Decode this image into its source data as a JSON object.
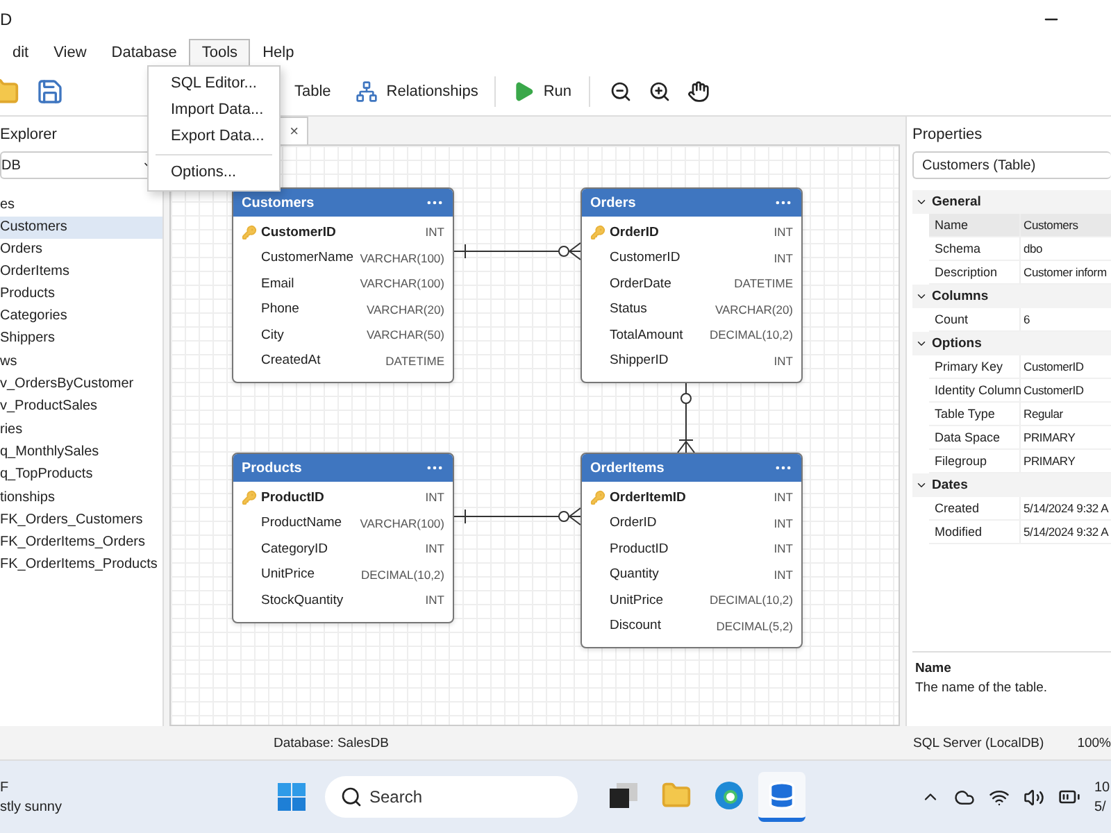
{
  "title_bar": {
    "title": "D"
  },
  "menu_bar": [
    {
      "label": "dit",
      "selected": false
    },
    {
      "label": "View",
      "selected": false
    },
    {
      "label": "Database",
      "selected": false
    },
    {
      "label": "Tools",
      "selected": true
    },
    {
      "label": "Help",
      "selected": false
    }
  ],
  "tools_menu": [
    {
      "kind": "item",
      "label": "SQL Editor..."
    },
    {
      "kind": "item",
      "label": "Import Data..."
    },
    {
      "kind": "item",
      "label": "Export Data..."
    },
    {
      "kind": "separator"
    },
    {
      "kind": "item",
      "label": "Options..."
    }
  ],
  "toolbar": [
    {
      "label": "Table"
    },
    {
      "label": "Relationships"
    },
    {
      "label": "Run"
    }
  ],
  "explorer": {
    "title": "Explorer",
    "database": "DB",
    "tree": [
      {
        "label": "es",
        "children": [
          {
            "label": "Customers",
            "selected": true
          },
          {
            "label": "Orders",
            "selected": false
          },
          {
            "label": "OrderItems",
            "selected": false
          },
          {
            "label": "Products",
            "selected": false
          },
          {
            "label": "Categories",
            "selected": false
          },
          {
            "label": "Shippers",
            "selected": false
          }
        ]
      },
      {
        "label": "ws",
        "children": [
          {
            "label": "v_OrdersByCustomer",
            "selected": false
          },
          {
            "label": "v_ProductSales",
            "selected": false
          }
        ]
      },
      {
        "label": "ries",
        "children": [
          {
            "label": "q_MonthlySales",
            "selected": false
          },
          {
            "label": "q_TopProducts",
            "selected": false
          }
        ]
      },
      {
        "label": "tionships",
        "children": [
          {
            "label": "FK_Orders_Customers",
            "selected": false
          },
          {
            "label": "FK_OrderItems_Orders",
            "selected": false
          },
          {
            "label": "FK_OrderItems_Products",
            "selected": false
          }
        ]
      }
    ]
  },
  "editor_tab": {
    "close": "×"
  },
  "diagram": {
    "entities": [
      {
        "name": "Customers",
        "columns": [
          {
            "name": "CustomerID",
            "type": "INT",
            "primary_key": true
          },
          {
            "name": "CustomerName",
            "type": "VARCHAR(100)",
            "primary_key": false
          },
          {
            "name": "Email",
            "type": "VARCHAR(100)",
            "primary_key": false
          },
          {
            "name": "Phone",
            "type": "VARCHAR(20)",
            "primary_key": false
          },
          {
            "name": "City",
            "type": "VARCHAR(50)",
            "primary_key": false
          },
          {
            "name": "CreatedAt",
            "type": "DATETIME",
            "primary_key": false
          }
        ]
      },
      {
        "name": "Orders",
        "columns": [
          {
            "name": "OrderID",
            "type": "INT",
            "primary_key": true
          },
          {
            "name": "CustomerID",
            "type": "INT",
            "primary_key": false
          },
          {
            "name": "OrderDate",
            "type": "DATETIME",
            "primary_key": false
          },
          {
            "name": "Status",
            "type": "VARCHAR(20)",
            "primary_key": false
          },
          {
            "name": "TotalAmount",
            "type": "DECIMAL(10,2)",
            "primary_key": false
          },
          {
            "name": "ShipperID",
            "type": "INT",
            "primary_key": false
          }
        ]
      },
      {
        "name": "Products",
        "columns": [
          {
            "name": "ProductID",
            "type": "INT",
            "primary_key": true
          },
          {
            "name": "ProductName",
            "type": "VARCHAR(100)",
            "primary_key": false
          },
          {
            "name": "CategoryID",
            "type": "INT",
            "primary_key": false
          },
          {
            "name": "UnitPrice",
            "type": "DECIMAL(10,2)",
            "primary_key": false
          },
          {
            "name": "StockQuantity",
            "type": "INT",
            "primary_key": false
          }
        ]
      },
      {
        "name": "OrderItems",
        "columns": [
          {
            "name": "OrderItemID",
            "type": "INT",
            "primary_key": true
          },
          {
            "name": "OrderID",
            "type": "INT",
            "primary_key": false
          },
          {
            "name": "ProductID",
            "type": "INT",
            "primary_key": false
          },
          {
            "name": "Quantity",
            "type": "INT",
            "primary_key": false
          },
          {
            "name": "UnitPrice",
            "type": "DECIMAL(10,2)",
            "primary_key": false
          },
          {
            "name": "Discount",
            "type": "DECIMAL(5,2)",
            "primary_key": false
          }
        ]
      }
    ]
  },
  "properties": {
    "title": "Properties",
    "object": "Customers (Table)",
    "groups": [
      {
        "label": "General",
        "rows": [
          {
            "name": "Name",
            "value": "Customers",
            "selected": true
          },
          {
            "name": "Schema",
            "value": "dbo",
            "selected": false
          },
          {
            "name": "Description",
            "value": "Customer inform",
            "selected": false
          }
        ]
      },
      {
        "label": "Columns",
        "rows": [
          {
            "name": "Count",
            "value": "6",
            "selected": false
          }
        ]
      },
      {
        "label": "Options",
        "rows": [
          {
            "name": "Primary Key",
            "value": "CustomerID",
            "selected": false
          },
          {
            "name": "Identity Column",
            "value": "CustomerID",
            "selected": false
          },
          {
            "name": "Table Type",
            "value": "Regular",
            "selected": false
          },
          {
            "name": "Data Space",
            "value": "PRIMARY",
            "selected": false
          },
          {
            "name": "Filegroup",
            "value": "PRIMARY",
            "selected": false
          }
        ]
      },
      {
        "label": "Dates",
        "rows": [
          {
            "name": "Created",
            "value": "5/14/2024 9:32 A",
            "selected": false
          },
          {
            "name": "Modified",
            "value": "5/14/2024 9:32 A",
            "selected": false
          }
        ]
      }
    ],
    "description": {
      "title": "Name",
      "text": "The name of the table."
    }
  },
  "status_bar": [
    "Database: SalesDB",
    "SQL Server (LocalDB)",
    "100%"
  ],
  "taskbar": {
    "weather": {
      "temperature": "F",
      "condition": "stly sunny"
    },
    "search": {
      "placeholder": "Search"
    },
    "apps": [
      {
        "selected": false
      },
      {
        "selected": false
      },
      {
        "selected": false
      },
      {
        "selected": true
      }
    ],
    "clock": {
      "time": "10",
      "date": "5/"
    }
  }
}
